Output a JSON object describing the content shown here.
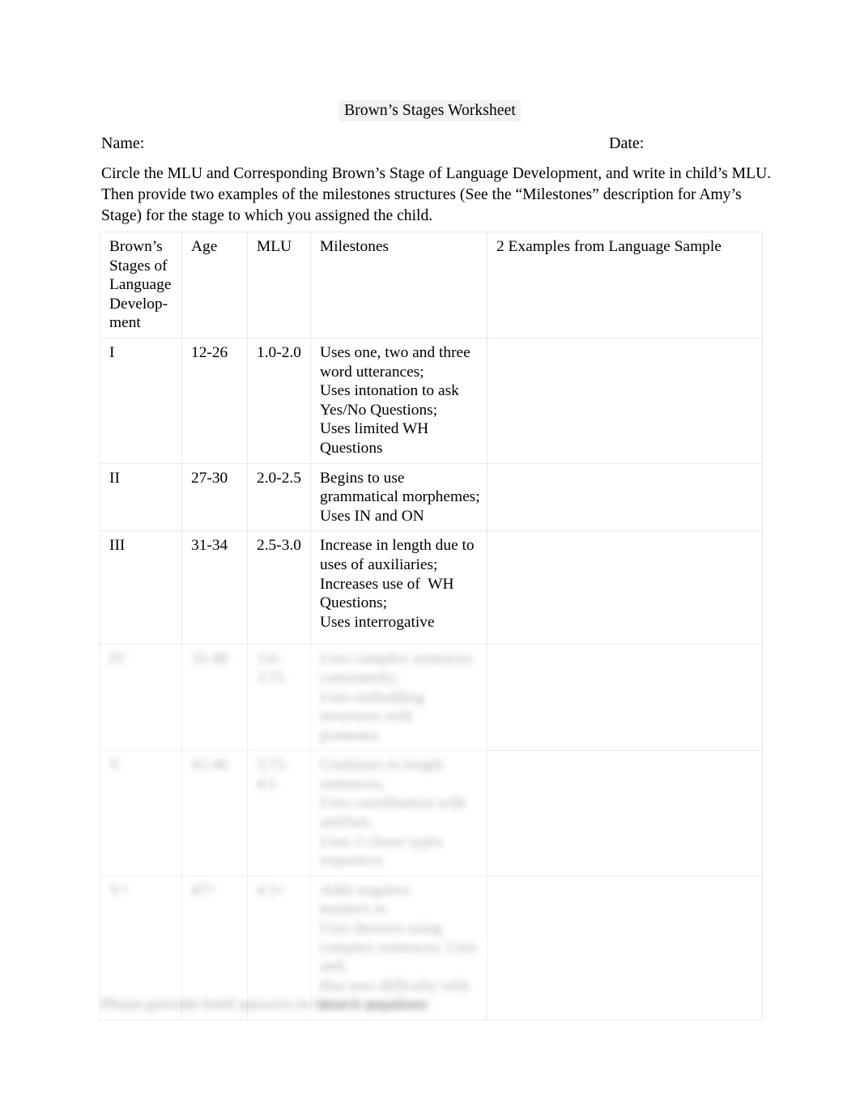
{
  "document": {
    "title": "Brown’s Stages Worksheet",
    "name_label": "Name:",
    "date_label": "Date:",
    "instructions": [
      "Circle the MLU and Corresponding Brown’s Stage of Language Development, and write in child’s MLU.",
      "Then provide two examples of the milestones structures (See the “Milestones” description for Amy’s",
      "Stage) for the stage to which you assigned the child."
    ],
    "footer_note": "Please provide brief answers to these 2 questions:"
  },
  "table": {
    "headers": {
      "stage": [
        "Brown’s",
        "Stages of",
        "Language",
        "Develop-",
        "ment"
      ],
      "age": "Age",
      "mlu": "MLU",
      "milestones": "Milestones",
      "examples": "2 Examples from Language Sample"
    },
    "rows": [
      {
        "stage": "I",
        "age": "12-26",
        "mlu": "1.0-2.0",
        "milestones": [
          "Uses one, two and three",
          "word utterances;",
          "Uses intonation to ask",
          "Yes/No Questions;",
          "Uses limited WH",
          "Questions"
        ],
        "examples": "",
        "redacted": false
      },
      {
        "stage": "II",
        "age": "27-30",
        "mlu": "2.0-2.5",
        "milestones": [
          "Begins to use",
          "grammatical morphemes;",
          "Uses IN and ON"
        ],
        "examples": "",
        "redacted": false
      },
      {
        "stage": "III",
        "age": "31-34",
        "mlu": "2.5-3.0",
        "milestones": [
          "Increase in length due to",
          "uses of auxiliaries;",
          "Increases use of  WH",
          "Questions;",
          "Uses interrogative"
        ],
        "examples": "",
        "redacted": false
      },
      {
        "stage": "IV",
        "age": "35-40",
        "mlu": "3.0-3.75",
        "milestones": [
          "Uses complex sentences",
          "consistently;",
          "Uses embedding",
          "structures with",
          "pronouns"
        ],
        "examples": "",
        "redacted": true
      },
      {
        "stage": "V",
        "age": "41-46",
        "mlu": "3.75-4.5",
        "milestones": [
          "Continues to length",
          "sentences;",
          "Uses coordination with",
          "and/but;",
          "Uses 3 clause types",
          "sequences"
        ],
        "examples": "",
        "redacted": true
      },
      {
        "stage": "V+",
        "age": "47+",
        "mlu": "4.5+",
        "milestones": [
          "Adds negative",
          "markers to",
          "Uses theories using",
          "complex sentences; Uses",
          "and;",
          "Has uses difficulty with",
          "double negatives"
        ],
        "examples": "",
        "redacted": true
      }
    ]
  }
}
